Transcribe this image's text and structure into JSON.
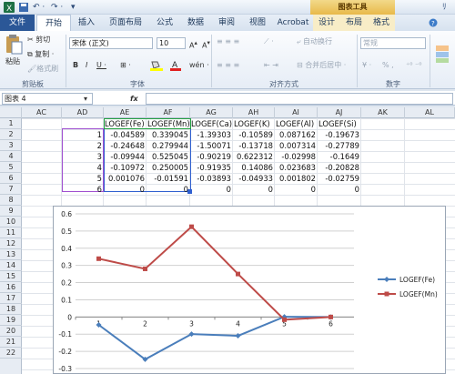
{
  "title_bar": {
    "context_title": "图表工具",
    "right_text": "ﾘ"
  },
  "tabs": [
    "文件",
    "开始",
    "插入",
    "页面布局",
    "公式",
    "数据",
    "审阅",
    "视图",
    "Acrobat",
    "设计",
    "布局",
    "格式"
  ],
  "ribbon": {
    "paste": "粘贴",
    "cut": "剪切",
    "copy": "复制 ·",
    "format_painter": "格式刷",
    "clipboard_group": "剪贴板",
    "font_name": "宋体 (正文)",
    "font_size": "10",
    "bold": "B",
    "italic": "I",
    "underline": "U ·",
    "font_group": "字体",
    "wrap_text": "自动换行",
    "merge_center": "合并后居中 ·",
    "align_group": "对齐方式",
    "number_format": "常规",
    "percent": "% ,",
    "number_group": "数字"
  },
  "formula_bar": {
    "name_box": "图表 4",
    "fx": "fx"
  },
  "columns": [
    "AC",
    "AD",
    "AE",
    "AF",
    "AG",
    "AH",
    "AI",
    "AJ",
    "AK",
    "AL"
  ],
  "rows": [
    "1",
    "2",
    "3",
    "4",
    "5",
    "6",
    "7",
    "8",
    "9",
    "10",
    "11",
    "12",
    "13",
    "14",
    "15",
    "16",
    "17",
    "18",
    "19",
    "20",
    "21",
    "22"
  ],
  "table": {
    "headers": [
      "LOGEF(Fe)",
      "LOGEF(Mn)",
      "LOGEF(Ca)",
      "LOGEF(K)",
      "LOGEF(Al)",
      "LOGEF(Si)"
    ],
    "index": [
      "1",
      "2",
      "3",
      "4",
      "5",
      "6"
    ],
    "values": [
      [
        "-0.04589",
        "0.339045",
        "-1.39303",
        "-0.10589",
        "0.087162",
        "-0.19673"
      ],
      [
        "-0.24648",
        "0.279944",
        "-1.50071",
        "-0.13718",
        "0.007314",
        "-0.27789"
      ],
      [
        "-0.09944",
        "0.525045",
        "-0.90219",
        "0.622312",
        "-0.02998",
        "-0.1649"
      ],
      [
        "-0.10972",
        "0.250005",
        "-0.91935",
        "0.14086",
        "0.023683",
        "-0.20828"
      ],
      [
        "0.001076",
        "-0.01591",
        "-0.03893",
        "-0.04933",
        "0.001802",
        "-0.02759"
      ],
      [
        "0",
        "0",
        "0",
        "0",
        "0",
        "0"
      ]
    ]
  },
  "chart_data": {
    "type": "line",
    "categories": [
      "1",
      "2",
      "3",
      "4",
      "5",
      "6"
    ],
    "series": [
      {
        "name": "LOGEF(Fe)",
        "color": "#4a7ebb",
        "values": [
          -0.04589,
          -0.24648,
          -0.09944,
          -0.10972,
          0.001076,
          0
        ]
      },
      {
        "name": "LOGEF(Mn)",
        "color": "#be4b48",
        "values": [
          0.339045,
          0.279944,
          0.525045,
          0.250005,
          -0.01591,
          0
        ]
      }
    ],
    "ylim": [
      -0.3,
      0.6
    ],
    "yticks": [
      "0.6",
      "0.5",
      "0.4",
      "0.3",
      "0.2",
      "0.1",
      "0",
      "-0.1",
      "-0.2",
      "-0.3"
    ],
    "legend": "right",
    "grid": true
  }
}
